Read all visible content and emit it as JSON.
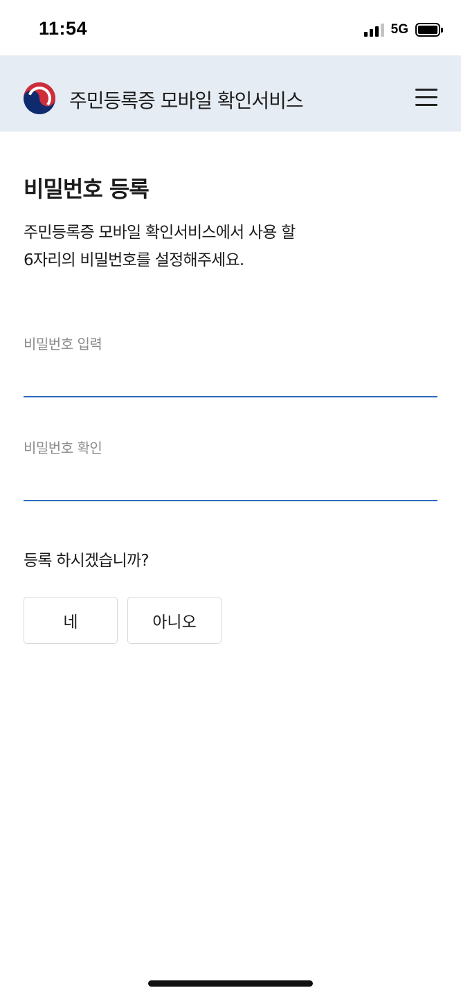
{
  "status_bar": {
    "time": "11:54",
    "network": "5G",
    "icons": [
      "signal-icon",
      "battery-icon"
    ]
  },
  "header": {
    "title": "주민등록증 모바일 확인서비스",
    "logo_icon": "taegeuk-logo-icon",
    "menu_icon": "hamburger-menu-icon",
    "colors": {
      "background": "#e6ecf4",
      "logo_red": "#cd2e3a",
      "logo_blue": "#0f2b6e"
    }
  },
  "main": {
    "title": "비밀번호 등록",
    "description_line1": "주민등록증 모바일 확인서비스에서 사용 할",
    "description_line2": "6자리의 비밀번호를 설정해주세요.",
    "fields": [
      {
        "label": "비밀번호 입력",
        "value": ""
      },
      {
        "label": "비밀번호 확인",
        "value": ""
      }
    ],
    "question": "등록 하시겠습니까?",
    "buttons": {
      "yes": "네",
      "no": "아니오"
    },
    "colors": {
      "input_underline": "#2d6bbf"
    }
  }
}
